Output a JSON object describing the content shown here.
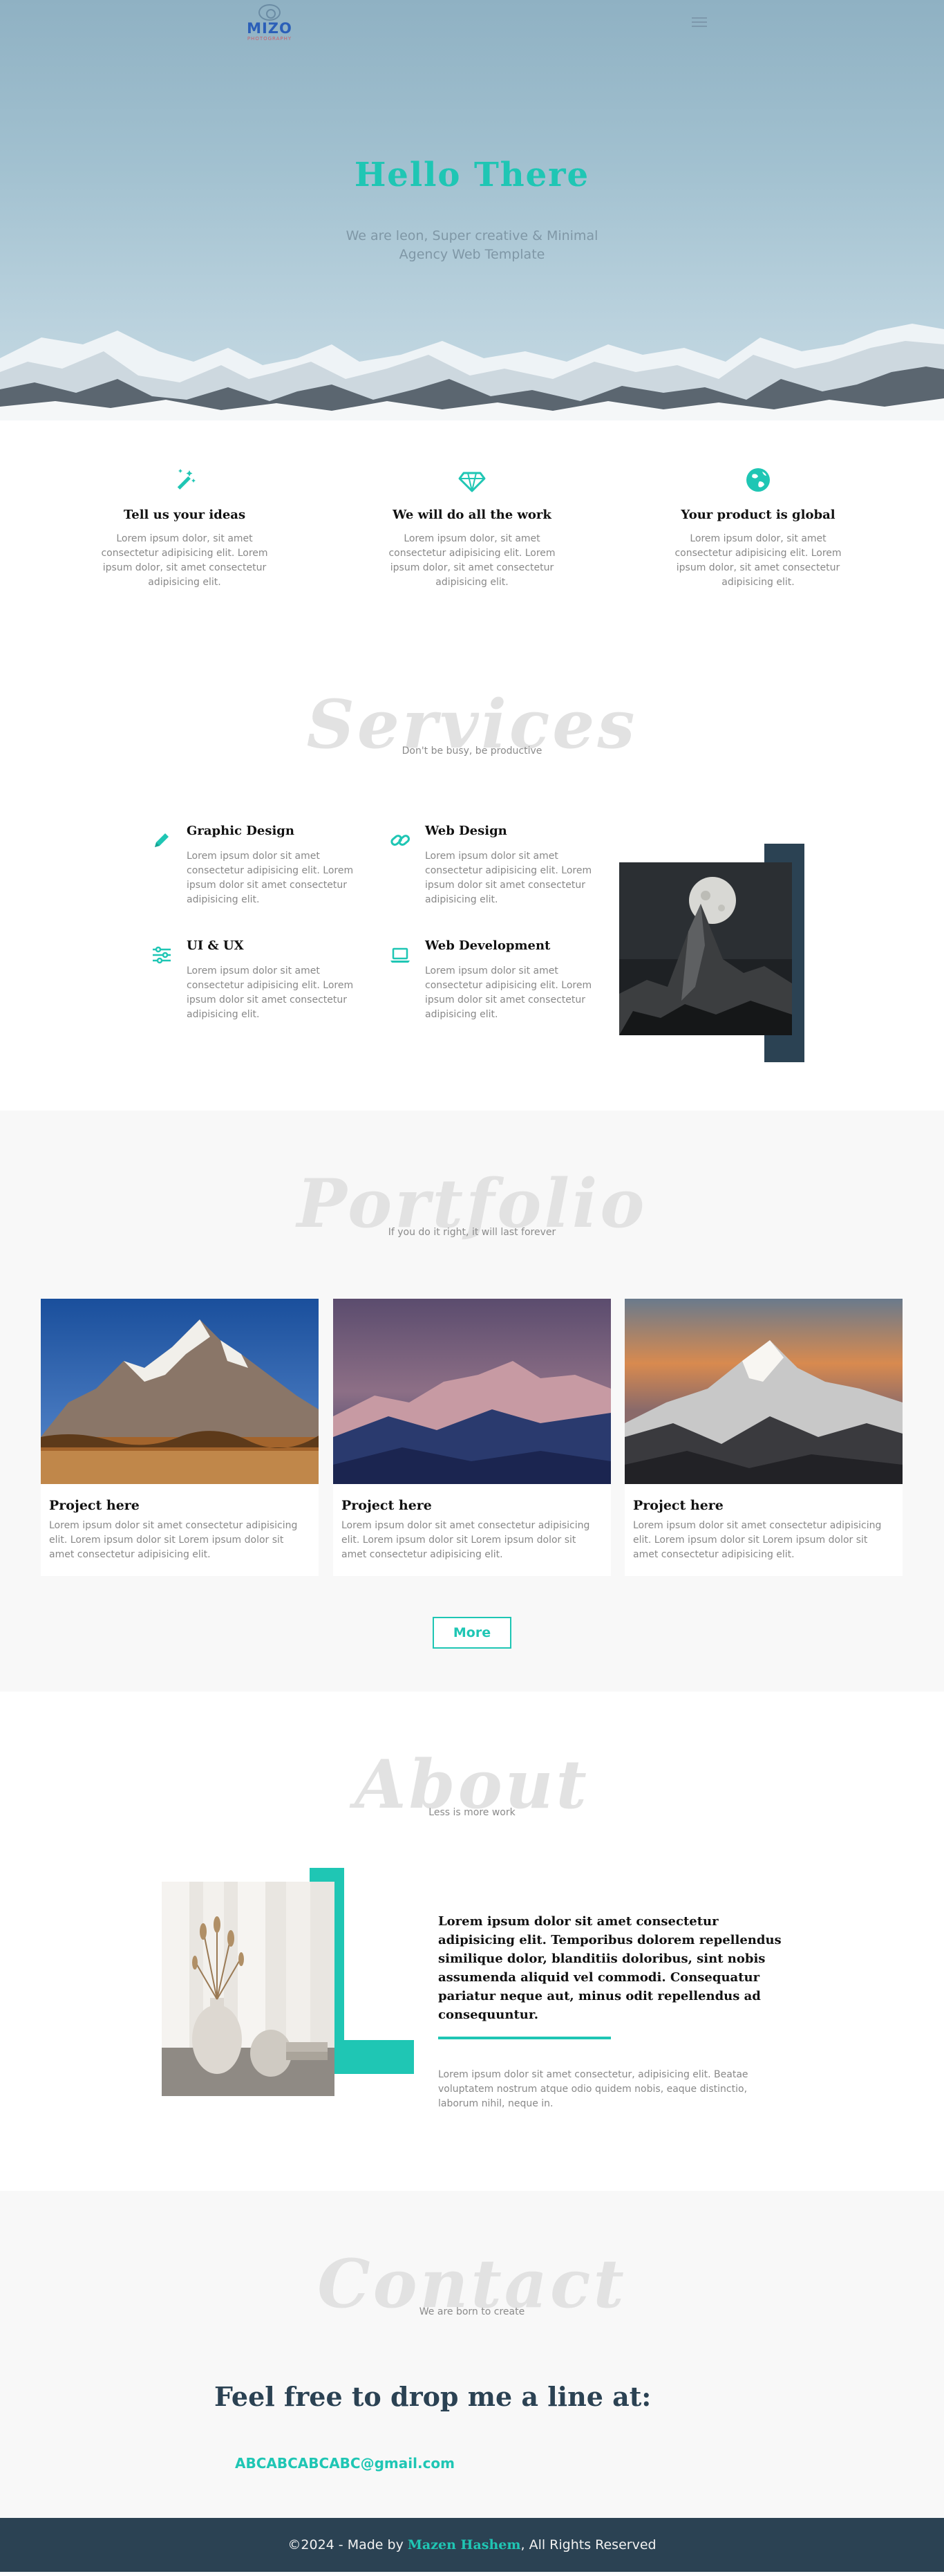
{
  "header": {
    "logo_name": "MIZO",
    "logo_sub": "PHOTOGRAPHY",
    "hero_title": "Hello There",
    "hero_text": "We are leon, Super creative & Minimal Agency Web Template"
  },
  "features": [
    {
      "icon": "magic-wand-icon",
      "title": "Tell us your ideas",
      "text": "Lorem ipsum dolor, sit amet consectetur adipisicing elit. Lorem ipsum dolor, sit amet consectetur adipisicing elit."
    },
    {
      "icon": "diamond-icon",
      "title": "We will do all the work",
      "text": "Lorem ipsum dolor, sit amet consectetur adipisicing elit. Lorem ipsum dolor, sit amet consectetur adipisicing elit."
    },
    {
      "icon": "globe-icon",
      "title": "Your product is global",
      "text": "Lorem ipsum dolor, sit amet consectetur adipisicing elit. Lorem ipsum dolor, sit amet consectetur adipisicing elit."
    }
  ],
  "services": {
    "heading": "Services",
    "tagline": "Don't be busy, be productive",
    "items": [
      {
        "icon": "pencil-icon",
        "title": "Graphic Design",
        "text": "Lorem ipsum dolor sit amet consectetur adipisicing elit. Lorem ipsum dolor sit amet consectetur adipisicing elit."
      },
      {
        "icon": "link-icon",
        "title": "Web Design",
        "text": "Lorem ipsum dolor sit amet consectetur adipisicing elit. Lorem ipsum dolor sit amet consectetur adipisicing elit."
      },
      {
        "icon": "sliders-icon",
        "title": "UI & UX",
        "text": "Lorem ipsum dolor sit amet consectetur adipisicing elit. Lorem ipsum dolor sit amet consectetur adipisicing elit."
      },
      {
        "icon": "laptop-icon",
        "title": "Web Development",
        "text": "Lorem ipsum dolor sit amet consectetur adipisicing elit. Lorem ipsum dolor sit amet consectetur adipisicing elit."
      }
    ]
  },
  "portfolio": {
    "heading": "Portfolio",
    "tagline": "If you do it right, it will last forever",
    "projects": [
      {
        "title": "Project here",
        "text": "Lorem ipsum dolor sit amet consectetur adipisicing elit. Lorem ipsum dolor sit Lorem ipsum dolor sit amet consectetur adipisicing elit."
      },
      {
        "title": "Project here",
        "text": "Lorem ipsum dolor sit amet consectetur adipisicing elit. Lorem ipsum dolor sit Lorem ipsum dolor sit amet consectetur adipisicing elit."
      },
      {
        "title": "Project here",
        "text": "Lorem ipsum dolor sit amet consectetur adipisicing elit. Lorem ipsum dolor sit Lorem ipsum dolor sit amet consectetur adipisicing elit."
      }
    ],
    "more_label": "More"
  },
  "about": {
    "heading": "About",
    "tagline": "Less is more work",
    "lead": "Lorem ipsum dolor sit amet consectetur adipisicing elit. Temporibus dolorem repellendus similique dolor, blanditiis doloribus, sint nobis assumenda aliquid vel commodi. Consequatur pariatur neque aut, minus odit repellendus ad consequuntur.",
    "text": "Lorem ipsum dolor sit amet consectetur, adipisicing elit. Beatae voluptatem nostrum atque odio quidem nobis, eaque distinctio, laborum nihil, neque in."
  },
  "contact": {
    "heading": "Contact",
    "tagline": "We are born to create",
    "title": "Feel free to drop me a line at:",
    "email": "ABCABCABCABC@gmail.com"
  },
  "footer": {
    "prefix": "©2024 - Made by",
    "author": "Mazen Hashem",
    "suffix": ", All Rights Reserved"
  },
  "colors": {
    "accent": "#1fc6b4",
    "dark": "#2b4253",
    "muted": "#888888",
    "light_bg": "#f8f8f8"
  }
}
